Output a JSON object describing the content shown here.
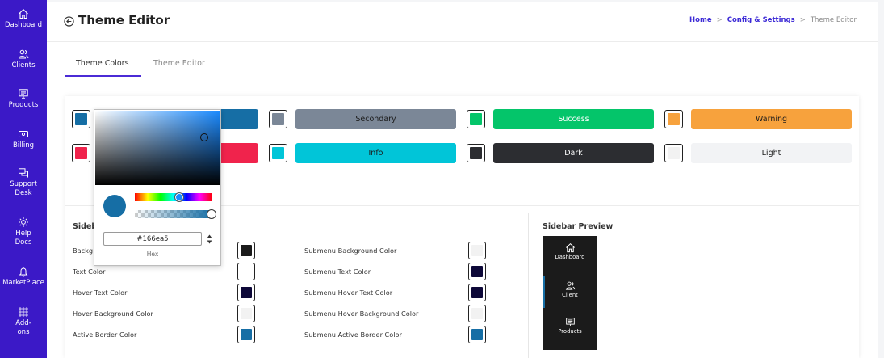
{
  "nav": {
    "items": [
      {
        "label": "Dashboard"
      },
      {
        "label": "Clients"
      },
      {
        "label": "Products"
      },
      {
        "label": "Billing"
      },
      {
        "label": "Support Desk"
      },
      {
        "label": "Help Docs"
      },
      {
        "label": "MarketPlace"
      },
      {
        "label": "Add-ons"
      }
    ]
  },
  "header": {
    "title": "Theme Editor",
    "breadcrumb": [
      "Home",
      "Config & Settings",
      "Theme Editor"
    ],
    "separator": ">"
  },
  "tabs": [
    {
      "label": "Theme Colors",
      "active": true
    },
    {
      "label": "Theme Editor",
      "active": false
    }
  ],
  "theme_colors": [
    {
      "label": "",
      "swatch": "#166ea5",
      "button": "#166ea5",
      "text_color": "#ffffff"
    },
    {
      "label": "Secondary",
      "swatch": "#7b8797",
      "button": "#7b8797",
      "text_color": "#1b1b1b"
    },
    {
      "label": "Success",
      "swatch": "#04c56a",
      "button": "#04c56a",
      "text_color": "#ffffff"
    },
    {
      "label": "Warning",
      "swatch": "#f7a23d",
      "button": "#f7a23d",
      "text_color": "#1b1b1b"
    },
    {
      "label": "",
      "swatch": "#f0234c",
      "button": "#f0234c",
      "text_color": "#ffffff"
    },
    {
      "label": "Info",
      "swatch": "#01c5d8",
      "button": "#01c5d8",
      "text_color": "#1b1b1b"
    },
    {
      "label": "Dark",
      "swatch": "#2c2d31",
      "button": "#2c2d31",
      "text_color": "#ffffff"
    },
    {
      "label": "Light",
      "swatch": "#f2f2f2",
      "button": "#f2f3f5",
      "text_color": "#1b1b1b"
    }
  ],
  "sidebar_settings": {
    "title_partial": "Sideb",
    "left": [
      {
        "label": "Backg",
        "color": "#1b1b1b"
      },
      {
        "label": "Text Color",
        "color": "#ffffff"
      },
      {
        "label": "Hover Text Color",
        "color": "#0d0838"
      },
      {
        "label": "Hover Background Color",
        "color": "#f2f2f2"
      },
      {
        "label": "Active Border Color",
        "color": "#166ea5"
      }
    ],
    "right": [
      {
        "label": "Submenu Background Color",
        "color": "#f2f2f2"
      },
      {
        "label": "Submenu Text Color",
        "color": "#0d0838"
      },
      {
        "label": "Submenu Hover Text Color",
        "color": "#0d0838"
      },
      {
        "label": "Submenu Hover Background Color",
        "color": "#f2f2f2"
      },
      {
        "label": "Submenu Active Border Color",
        "color": "#166ea5"
      }
    ]
  },
  "sidebar_preview": {
    "title": "Sidebar Preview",
    "items": [
      {
        "label": "Dashboard"
      },
      {
        "label": "Client"
      },
      {
        "label": "Products"
      }
    ]
  },
  "color_picker": {
    "hex_value": "#166ea5",
    "mode_label": "Hex",
    "current_color": "#166ea5"
  }
}
